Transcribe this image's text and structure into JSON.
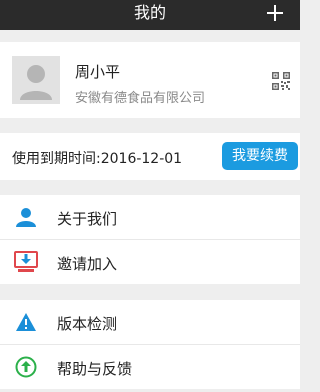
{
  "header": {
    "title": "我的",
    "add_icon": "plus-icon"
  },
  "profile": {
    "name": "周小平",
    "company": "安徽有德食品有限公司",
    "qr_icon": "qr-code-icon"
  },
  "subscription": {
    "expiry_text": "使用到期时间:2016-12-01",
    "renew_label": "我要续费",
    "renew_color": "#1b9be0"
  },
  "menu_group1": [
    {
      "label": "关于我们",
      "icon": "user-icon",
      "color": "#1b8fd8"
    },
    {
      "label": "邀请加入",
      "icon": "monitor-download-icon",
      "color": "#e0474c"
    }
  ],
  "menu_group2": [
    {
      "label": "版本检测",
      "icon": "warning-icon",
      "color": "#1b8fd8"
    },
    {
      "label": "帮助与反馈",
      "icon": "up-arrow-circle-icon",
      "color": "#2bb04a"
    }
  ]
}
